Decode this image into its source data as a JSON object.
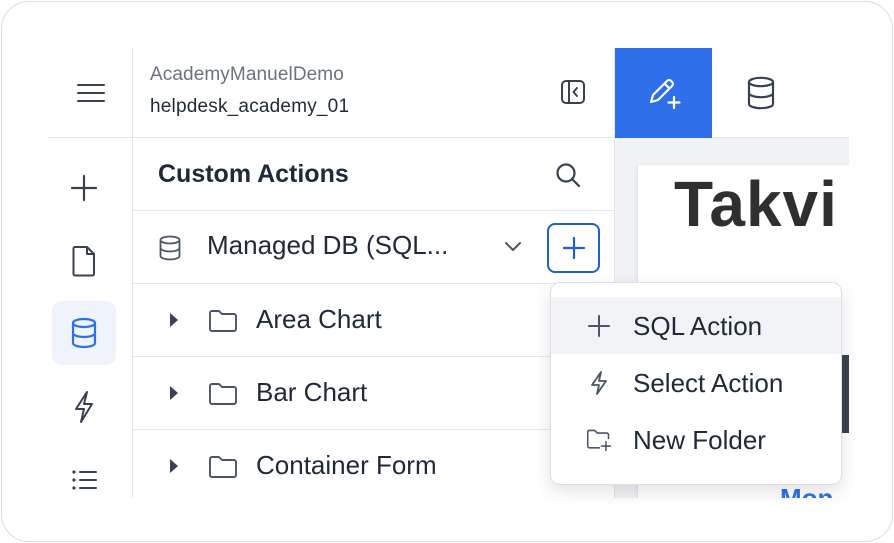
{
  "header": {
    "org_name": "AcademyManuelDemo",
    "database_name": "helpdesk_academy_01"
  },
  "explorer": {
    "section_title": "Custom Actions",
    "db_source": "Managed DB (SQL...",
    "items": [
      {
        "label": "Area Chart"
      },
      {
        "label": "Bar Chart"
      },
      {
        "label": "Container Form"
      }
    ]
  },
  "dropdown": {
    "items": [
      {
        "label": "SQL Action",
        "icon": "plus-icon"
      },
      {
        "label": "Select Action",
        "icon": "lightning-icon"
      },
      {
        "label": "New Folder",
        "icon": "folder-plus-icon"
      }
    ]
  },
  "preview": {
    "title": "Takvi",
    "link_text": "Mon"
  },
  "colors": {
    "accent": "#2f6fea",
    "add_border": "#1f5fcf",
    "active_rail_bg": "#eef3fc",
    "text": "#1f2937",
    "muted": "#6b7280"
  }
}
